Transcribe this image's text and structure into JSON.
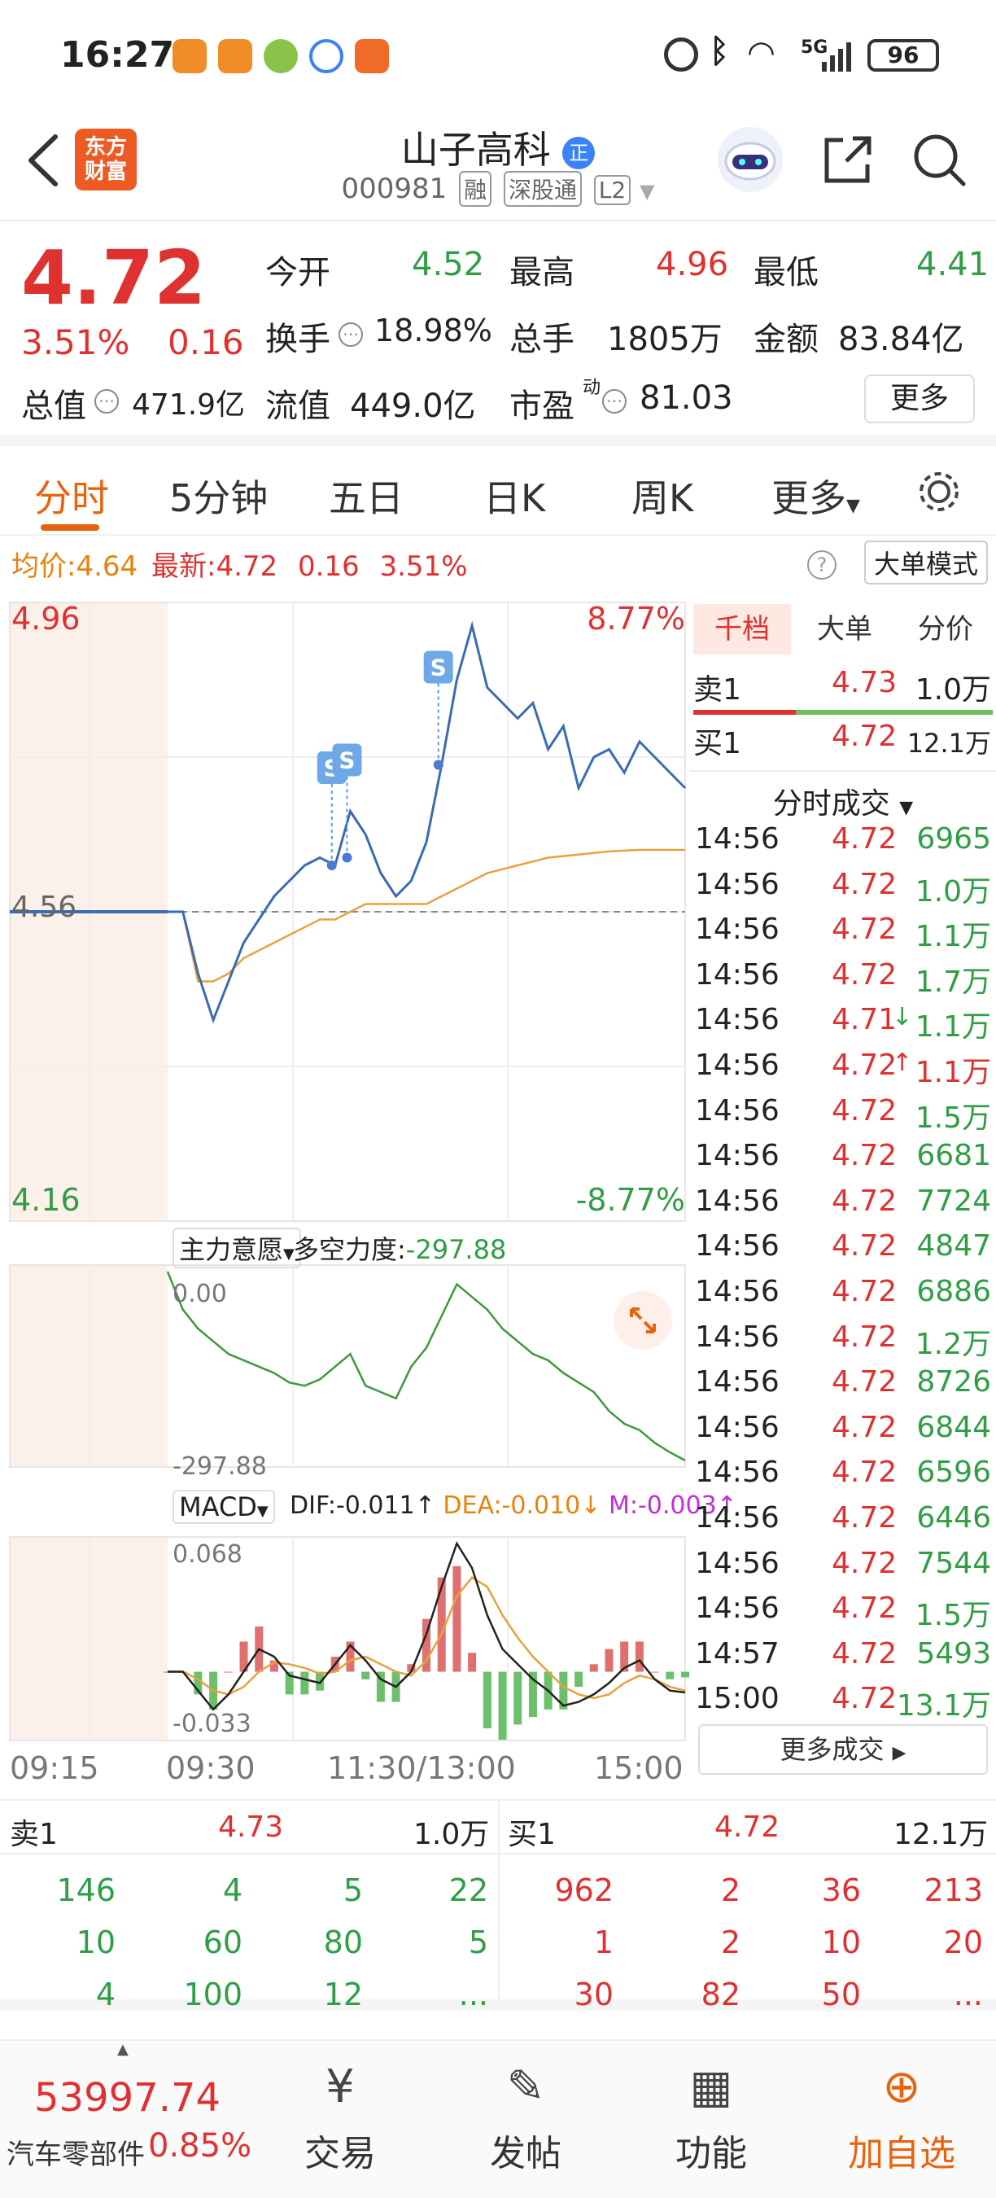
{
  "status_bar": {
    "time": "16:27",
    "battery": "96",
    "signal_label": "5G"
  },
  "header": {
    "logo_text": "东方\n财富",
    "logo_line1": "东方",
    "logo_line2": "财富",
    "stock_name": "山子高科",
    "name_badge": "正",
    "stock_code": "000981",
    "tags": [
      "融",
      "深股通",
      "L2"
    ]
  },
  "quote": {
    "price": "4.72",
    "change_pct": "3.51%",
    "change": "0.16",
    "open_label": "今开",
    "open": "4.52",
    "high_label": "最高",
    "high": "4.96",
    "low_label": "最低",
    "low": "4.41",
    "turnover_label": "换手",
    "turnover": "18.98%",
    "volume_label": "总手",
    "volume": "1805万",
    "amount_label": "金额",
    "amount": "83.84亿",
    "total_cap_label": "总值",
    "total_cap": "471.9亿",
    "float_cap_label": "流值",
    "float_cap": "449.0亿",
    "pe_label": "市盈",
    "pe_sup": "动",
    "pe": "81.03",
    "more_button": "更多"
  },
  "tabs": [
    "分时",
    "5分钟",
    "五日",
    "日K",
    "周K",
    "更多"
  ],
  "info_bar": {
    "avg_label": "均价:",
    "avg": "4.64",
    "latest_label": "最新:",
    "latest": "4.72",
    "latest_change": "0.16",
    "latest_pct": "3.51%",
    "mode_button": "大单模式"
  },
  "chart_data": [
    {
      "type": "line",
      "y_top_label": "4.96",
      "y_bottom_label": "4.16",
      "y_mid_label": "4.56",
      "pct_top_label": "8.77%",
      "pct_bottom_label": "-8.77%",
      "x_ticks": [
        "09:15",
        "09:30",
        "11:30/13:00",
        "15:00"
      ],
      "ylim": [
        4.16,
        4.96
      ],
      "prev_close": 4.56,
      "markers": [
        "S",
        "S",
        "S"
      ],
      "series": [
        {
          "values": [
            4.56,
            4.56,
            4.48,
            4.42,
            4.47,
            4.52,
            4.55,
            4.58,
            4.6,
            4.62,
            4.63,
            4.62,
            4.69,
            4.66,
            4.61,
            4.58,
            4.6,
            4.65,
            4.75,
            4.86,
            4.93,
            4.85,
            4.83,
            4.81,
            4.83,
            4.77,
            4.8,
            4.72,
            4.76,
            4.77,
            4.74,
            4.78,
            4.76,
            4.74,
            4.72
          ]
        },
        {
          "values": [
            4.56,
            4.56,
            4.47,
            4.47,
            4.48,
            4.5,
            4.51,
            4.52,
            4.53,
            4.54,
            4.55,
            4.55,
            4.56,
            4.57,
            4.57,
            4.57,
            4.57,
            4.57,
            4.58,
            4.59,
            4.6,
            4.61,
            4.615,
            4.62,
            4.625,
            4.63,
            4.632,
            4.634,
            4.636,
            4.638,
            4.639,
            4.64,
            4.64,
            4.64,
            4.64
          ]
        }
      ]
    },
    {
      "type": "line",
      "indicator_label": "主力意愿",
      "value_label": "多空力度:",
      "value": "-297.88",
      "y_top_label": "0.00",
      "y_bottom_label": "-297.88",
      "ylim": [
        -297.88,
        0
      ],
      "series": [
        {
          "values": [
            0,
            -60,
            -90,
            -110,
            -130,
            -140,
            -150,
            -160,
            -175,
            -180,
            -170,
            -150,
            -130,
            -180,
            -190,
            -200,
            -150,
            -120,
            -70,
            -20,
            -40,
            -60,
            -90,
            -110,
            -130,
            -140,
            -160,
            -175,
            -190,
            -220,
            -240,
            -250,
            -270,
            -285,
            -297.88
          ]
        }
      ]
    },
    {
      "type": "bar",
      "indicator_label": "MACD",
      "dif_label": "DIF:-0.011",
      "dea_label": "DEA:-0.010",
      "m_label": "M:-0.003",
      "y_top_label": "0.068",
      "y_bottom_label": "-0.033",
      "ylim": [
        -0.033,
        0.068
      ],
      "series": [
        {
          "name": "DIF",
          "values": [
            0,
            0.0,
            -0.01,
            -0.02,
            -0.012,
            0.0,
            0.012,
            0.008,
            -0.002,
            -0.004,
            -0.006,
            0.004,
            0.014,
            0.006,
            -0.004,
            -0.008,
            0.0,
            0.02,
            0.045,
            0.068,
            0.055,
            0.03,
            0.012,
            0.004,
            -0.004,
            -0.01,
            -0.018,
            -0.016,
            -0.012,
            -0.006,
            0.002,
            0.006,
            -0.004,
            -0.01,
            -0.011
          ]
        },
        {
          "name": "DEA",
          "values": [
            0,
            0.0,
            -0.004,
            -0.01,
            -0.012,
            -0.008,
            0.0,
            0.005,
            0.004,
            0.002,
            -0.001,
            0.0,
            0.006,
            0.008,
            0.004,
            0.0,
            -0.002,
            0.006,
            0.02,
            0.04,
            0.05,
            0.045,
            0.03,
            0.018,
            0.008,
            0.0,
            -0.008,
            -0.012,
            -0.014,
            -0.012,
            -0.006,
            -0.002,
            -0.004,
            -0.008,
            -0.01
          ]
        },
        {
          "name": "M",
          "values": [
            0,
            0,
            -0.012,
            -0.02,
            0,
            0.016,
            0.024,
            0.006,
            -0.012,
            -0.012,
            -0.01,
            0.008,
            0.016,
            -0.004,
            -0.016,
            -0.016,
            0.004,
            0.028,
            0.05,
            0.056,
            0.01,
            -0.03,
            -0.036,
            -0.028,
            -0.024,
            -0.02,
            -0.02,
            -0.008,
            0.004,
            0.012,
            0.016,
            0.016,
            0.0,
            -0.004,
            -0.003
          ]
        }
      ]
    }
  ],
  "right_panel": {
    "tabs": [
      "千档",
      "大单",
      "分价"
    ],
    "ask1_label": "卖1",
    "ask1_price": "4.73",
    "ask1_vol": "1.0万",
    "bid1_label": "买1",
    "bid1_price": "4.72",
    "bid1_vol": "12.1万",
    "trades_title": "分时成交",
    "trades": [
      {
        "time": "14:56",
        "price": "4.72",
        "vol": "6965",
        "dir": ""
      },
      {
        "time": "14:56",
        "price": "4.72",
        "vol": "1.0万",
        "dir": ""
      },
      {
        "time": "14:56",
        "price": "4.72",
        "vol": "1.1万",
        "dir": ""
      },
      {
        "time": "14:56",
        "price": "4.72",
        "vol": "1.7万",
        "dir": ""
      },
      {
        "time": "14:56",
        "price": "4.71",
        "vol": "1.1万",
        "dir": "↓"
      },
      {
        "time": "14:56",
        "price": "4.72",
        "vol": "1.1万",
        "dir": "↑"
      },
      {
        "time": "14:56",
        "price": "4.72",
        "vol": "1.5万",
        "dir": ""
      },
      {
        "time": "14:56",
        "price": "4.72",
        "vol": "6681",
        "dir": ""
      },
      {
        "time": "14:56",
        "price": "4.72",
        "vol": "7724",
        "dir": ""
      },
      {
        "time": "14:56",
        "price": "4.72",
        "vol": "4847",
        "dir": ""
      },
      {
        "time": "14:56",
        "price": "4.72",
        "vol": "6886",
        "dir": ""
      },
      {
        "time": "14:56",
        "price": "4.72",
        "vol": "1.2万",
        "dir": ""
      },
      {
        "time": "14:56",
        "price": "4.72",
        "vol": "8726",
        "dir": ""
      },
      {
        "time": "14:56",
        "price": "4.72",
        "vol": "6844",
        "dir": ""
      },
      {
        "time": "14:56",
        "price": "4.72",
        "vol": "6596",
        "dir": ""
      },
      {
        "time": "14:56",
        "price": "4.72",
        "vol": "6446",
        "dir": ""
      },
      {
        "time": "14:56",
        "price": "4.72",
        "vol": "7544",
        "dir": ""
      },
      {
        "time": "14:56",
        "price": "4.72",
        "vol": "1.5万",
        "dir": ""
      },
      {
        "time": "14:57",
        "price": "4.72",
        "vol": "5493",
        "dir": ""
      },
      {
        "time": "15:00",
        "price": "4.72",
        "vol": "13.1万",
        "dir": ""
      }
    ],
    "more_trades": "更多成交"
  },
  "depth": {
    "ask_label": "卖1",
    "ask_price": "4.73",
    "ask_vol": "1.0万",
    "bid_label": "买1",
    "bid_price": "4.72",
    "bid_vol": "12.1万",
    "ask_queue": [
      [
        "146",
        "4",
        "5",
        "22"
      ],
      [
        "10",
        "60",
        "80",
        "5"
      ],
      [
        "4",
        "100",
        "12",
        "..."
      ]
    ],
    "bid_queue": [
      [
        "962",
        "2",
        "36",
        "213"
      ],
      [
        "1",
        "2",
        "10",
        "20"
      ],
      [
        "30",
        "82",
        "50",
        "..."
      ]
    ]
  },
  "bottom_nav": {
    "index_value": "53997.74",
    "index_name": "汽车零部件",
    "index_pct": "0.85%",
    "items": [
      "交易",
      "发帖",
      "功能",
      "加自选"
    ]
  },
  "colors": {
    "up": "#e03131",
    "down": "#2f9e44",
    "accent": "#e8630c",
    "price_line": "#3b6bb5",
    "avg_line": "#e8a23c"
  }
}
